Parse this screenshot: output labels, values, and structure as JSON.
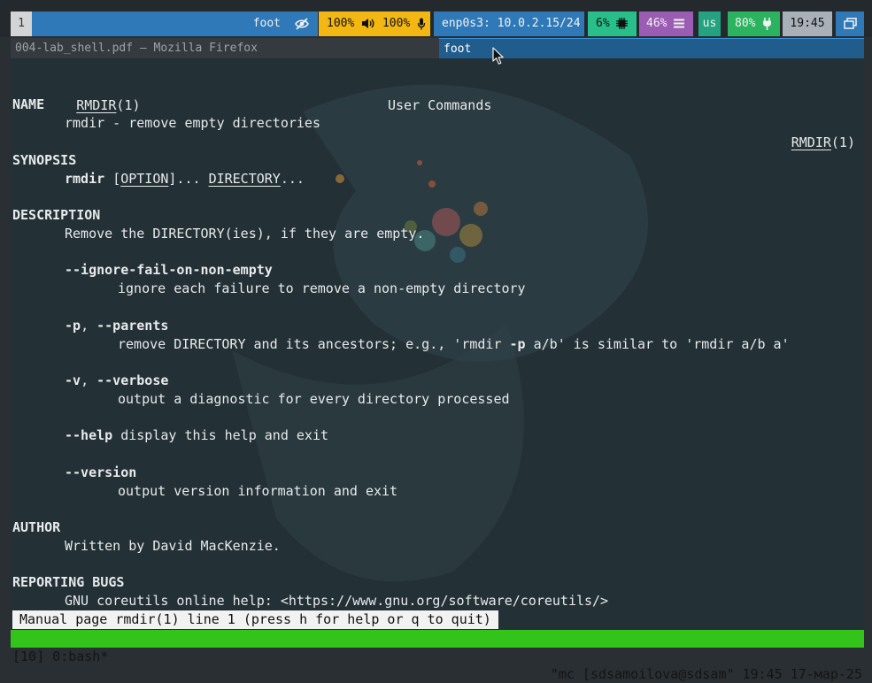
{
  "workspace": {
    "number": "1"
  },
  "status": {
    "title": "foot",
    "volume": "100%",
    "mic": "100%",
    "network": "enp0s3: 10.0.2.15/24",
    "cpu": "6%",
    "memory": "46%",
    "layout": "us",
    "battery": "80%",
    "clock": "19:45"
  },
  "colors": {
    "workspace": "#d2d4d6",
    "bar_blue": "#2f79b8",
    "volume": "#f2b713",
    "network": "#2f79b8",
    "cpu": "#28bf8b",
    "memory": "#9b5db4",
    "layout": "#25a381",
    "battery": "#2bb35f",
    "clock": "#a9b0b7",
    "tmux": "#33c41b"
  },
  "windows": [
    {
      "title": "004-lab_shell.pdf — Mozilla Firefox"
    },
    {
      "title": "foot"
    }
  ],
  "man": {
    "header_left": "RMDIR",
    "header_left_section": "(1)",
    "header_center": "User Commands",
    "header_right": "RMDIR",
    "header_right_section": "(1)",
    "name_heading": "NAME",
    "name_text": "rmdir - remove empty directories",
    "synopsis_heading": "SYNOPSIS",
    "synopsis_cmd": "rmdir",
    "synopsis_open": "[",
    "synopsis_option": "OPTION",
    "synopsis_close": "]...",
    "synopsis_dir": "DIRECTORY",
    "synopsis_ellipsis": "...",
    "description_heading": "DESCRIPTION",
    "description_text": "Remove the DIRECTORY(ies), if they are empty.",
    "opt1_name": "--ignore-fail-on-non-empty",
    "opt1_desc": "ignore each failure to remove a non-empty directory",
    "opt2_short": "-p",
    "opt2_sep": ", ",
    "opt2_long": "--parents",
    "opt2_desc_a": "remove DIRECTORY and its ancestors; e.g., 'rmdir ",
    "opt2_desc_flag": "-p",
    "opt2_desc_b": " a/b' is similar to 'rmdir a/b a'",
    "opt3_short": "-v",
    "opt3_sep": ", ",
    "opt3_long": "--verbose",
    "opt3_desc": "output a diagnostic for every directory processed",
    "opt4_name": "--help",
    "opt4_desc": " display this help and exit",
    "opt5_name": "--version",
    "opt5_desc": "output version information and exit",
    "author_heading": "AUTHOR",
    "author_text": "Written by David MacKenzie.",
    "bugs_heading": "REPORTING BUGS",
    "bugs_text": "GNU coreutils online help: <https://www.gnu.org/software/coreutils/>",
    "status_line": "Manual page rmdir(1) line 1 (press h for help or q to quit)"
  },
  "tmux": {
    "left": "[10] 0:bash*",
    "right": "\"mc [sdsamoilova@sdsam\" 19:45 17-мар-25"
  },
  "icons": {
    "hidden": "eye-slash-icon",
    "volume": "speaker-icon",
    "mic": "microphone-icon",
    "cpu": "cpu-chip-icon",
    "memory": "memory-bars-icon",
    "battery": "charging-plug-icon",
    "windows": "window-stack-icon",
    "pointer": "mouse-pointer-icon"
  }
}
